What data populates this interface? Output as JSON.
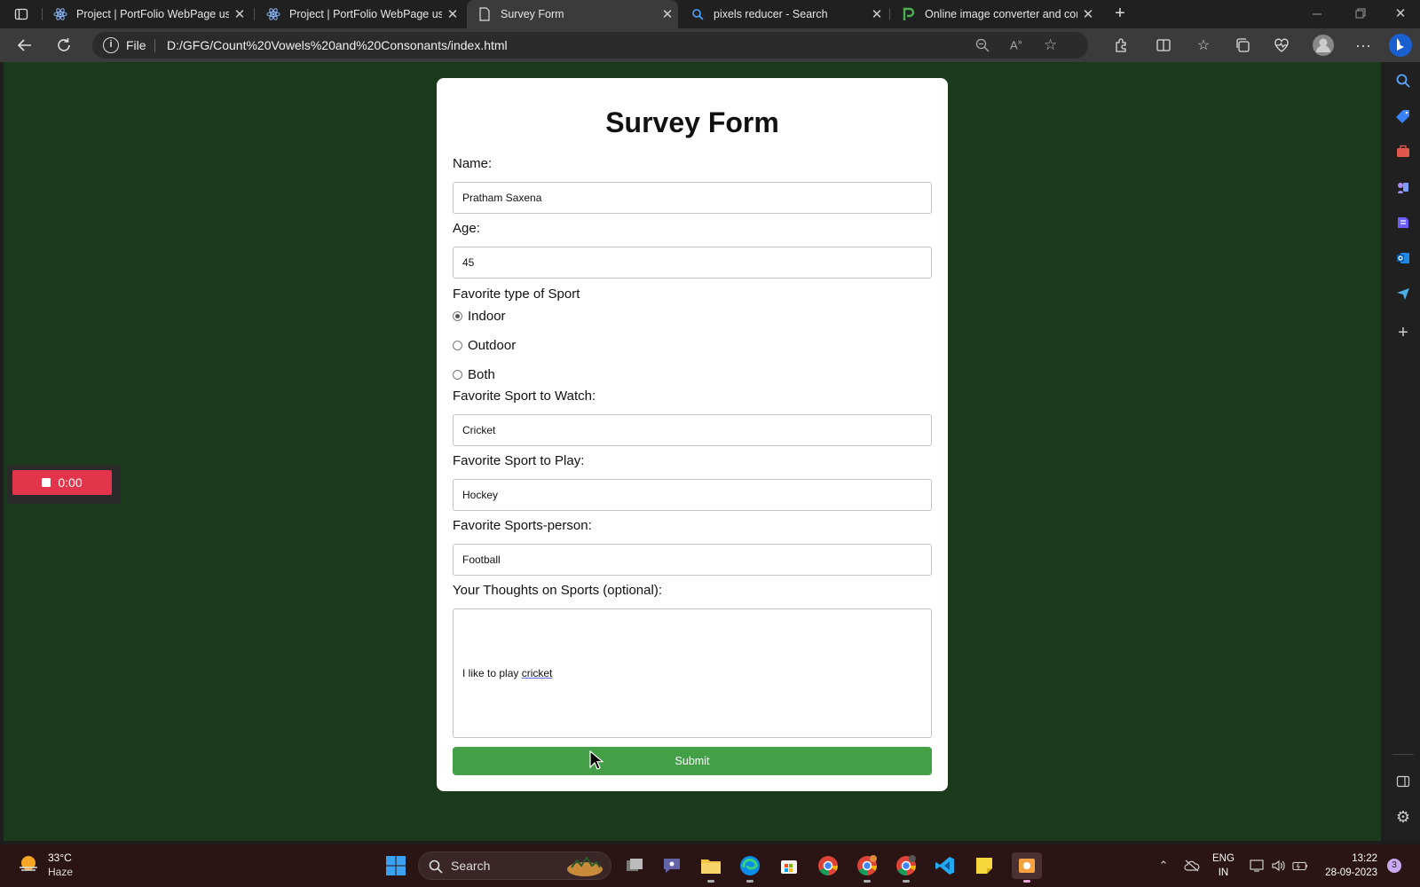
{
  "browser": {
    "tabs": [
      {
        "label": "Project | PortFolio WebPage using",
        "icon": "react-icon",
        "active": false
      },
      {
        "label": "Project | PortFolio WebPage using",
        "icon": "react-icon",
        "active": false
      },
      {
        "label": "Survey Form",
        "icon": "page-icon",
        "active": true
      },
      {
        "label": "pixels reducer - Search",
        "icon": "search-icon",
        "active": false
      },
      {
        "label": "Online image converter and com",
        "icon": "p-logo-icon",
        "active": false
      }
    ],
    "url_scheme": "File",
    "url": "D:/GFG/Count%20Vowels%20and%20Consonants/index.html"
  },
  "form": {
    "title": "Survey Form",
    "name_label": "Name:",
    "name_value": "Pratham Saxena",
    "age_label": "Age:",
    "age_value": "45",
    "sport_type_label": "Favorite type of Sport",
    "sport_type_options": [
      "Indoor",
      "Outdoor",
      "Both"
    ],
    "sport_type_selected": "Indoor",
    "watch_label": "Favorite Sport to Watch:",
    "watch_value": "Cricket",
    "play_label": "Favorite Sport to Play:",
    "play_value": "Hockey",
    "person_label": "Favorite Sports-person:",
    "person_value": "Football",
    "thoughts_label": "Your Thoughts on Sports (optional):",
    "thoughts_prefix": "I like to play ",
    "thoughts_word": "cricket",
    "submit_label": "Submit"
  },
  "recorder": {
    "time": "0:00"
  },
  "taskbar": {
    "weather_temp": "33°C",
    "weather_desc": "Haze",
    "search_label": "Search",
    "lang_top": "ENG",
    "lang_bottom": "IN",
    "time": "13:22",
    "date": "28-09-2023",
    "notification_count": "3"
  },
  "colors": {
    "page_bg": "#1b3a1b",
    "submit_bg": "#43a047",
    "record_red": "#e2344a",
    "taskbar_bg": "#2a1414"
  }
}
